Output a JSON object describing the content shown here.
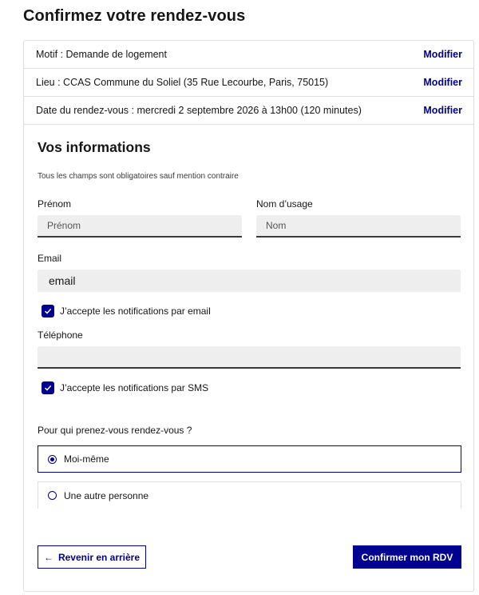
{
  "page": {
    "title": "Confirmez votre rendez-vous"
  },
  "summary": {
    "motif": "Motif : Demande de logement",
    "lieu": "Lieu : CCAS Commune du Soliel (35 Rue Lecourbe, Paris, 75015)",
    "date": "Date du rendez-vous : mercredi 2 septembre 2026 à 13h00 (120 minutes)",
    "modify_label": "Modifier"
  },
  "form": {
    "section_title": "Vos informations",
    "mandatory_note": "Tous les champs sont obligatoires sauf mention contraire",
    "prenom": {
      "label": "Prénom",
      "placeholder": "Prénom",
      "value": ""
    },
    "nom": {
      "label": "Nom d’usage",
      "placeholder": "Nom",
      "value": ""
    },
    "email": {
      "label": "Email",
      "placeholder": "email",
      "value": ""
    },
    "email_notifications": {
      "label": "J’accepte les notifications par email",
      "checked": true
    },
    "telephone": {
      "label": "Téléphone",
      "placeholder": "",
      "value": ""
    },
    "sms_notifications": {
      "label": "J’accepte les notifications par SMS",
      "checked": true
    },
    "for_whom": {
      "question": "Pour qui prenez-vous rendez-vous ?",
      "options": [
        {
          "label": "Moi-même",
          "selected": true
        },
        {
          "label": "Une autre personne",
          "selected": false
        }
      ]
    }
  },
  "actions": {
    "back_label": "Revenir en arrière",
    "back_icon": "arrow-left-icon",
    "confirm_label": "Confirmer mon RDV"
  },
  "colors": {
    "primary": "#000091",
    "input_bg": "#eeeeee",
    "border": "#dddddd",
    "text": "#161616"
  }
}
